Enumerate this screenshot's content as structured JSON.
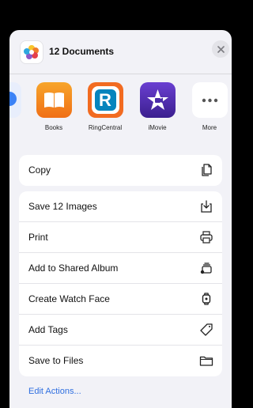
{
  "sheet": {
    "title": "12 Documents",
    "close_icon": "xmark-icon"
  },
  "apps": [
    {
      "label": "",
      "icon": "partial-app-icon",
      "color": "#3b82f6"
    },
    {
      "label": "Books",
      "icon": "books-icon",
      "color": "#f28a1d"
    },
    {
      "label": "RingCentral",
      "icon": "ringcentral-icon",
      "color": "#f26b21"
    },
    {
      "label": "iMovie",
      "icon": "imovie-icon",
      "color": "#4a2aa8"
    },
    {
      "label": "More",
      "icon": "more-icon",
      "color": "#ffffff"
    }
  ],
  "actions": {
    "copy": {
      "label": "Copy",
      "icon": "copy-icon"
    },
    "group2": [
      {
        "label": "Save 12 Images",
        "icon": "save-image-icon"
      },
      {
        "label": "Print",
        "icon": "printer-icon"
      },
      {
        "label": "Add to Shared Album",
        "icon": "shared-album-icon"
      },
      {
        "label": "Create Watch Face",
        "icon": "watch-icon"
      },
      {
        "label": "Add Tags",
        "icon": "tag-icon"
      },
      {
        "label": "Save to Files",
        "icon": "folder-icon"
      }
    ]
  },
  "edit_actions_label": "Edit Actions..."
}
